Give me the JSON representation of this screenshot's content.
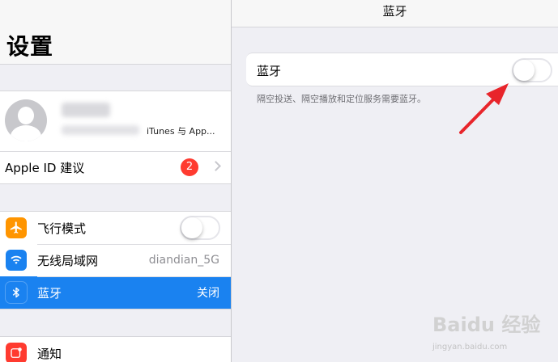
{
  "left": {
    "title": "设置",
    "profile": {
      "service": "iTunes 与 App..."
    },
    "apple_id_suggestion": {
      "label": "Apple ID 建议",
      "badge": "2"
    },
    "connectivity": [
      {
        "id": "airplane",
        "label": "飞行模式",
        "icon": "airplane-icon",
        "icon_color": "#ff9500",
        "type": "toggle",
        "on": false
      },
      {
        "id": "wifi",
        "label": "无线局域网",
        "icon": "wifi-icon",
        "icon_color": "#1a82f0",
        "value": "diandian_5G"
      },
      {
        "id": "bluetooth",
        "label": "蓝牙",
        "icon": "bluetooth-icon",
        "icon_color": "#1a82f0",
        "value": "关闭",
        "selected": true
      }
    ],
    "notifications": {
      "label": "通知",
      "icon": "notifications-icon",
      "icon_color": "#ff3b30"
    }
  },
  "right": {
    "title": "蓝牙",
    "bluetooth_label": "蓝牙",
    "bluetooth_on": false,
    "footer": "隔空投送、隔空播放和定位服务需要蓝牙。"
  },
  "colors": {
    "accent": "#1a82f0",
    "badge": "#ff3b30",
    "annotation_arrow": "#e8252b"
  },
  "watermark": {
    "brand": "Baidu 经验",
    "url": "jingyan.baidu.com"
  }
}
